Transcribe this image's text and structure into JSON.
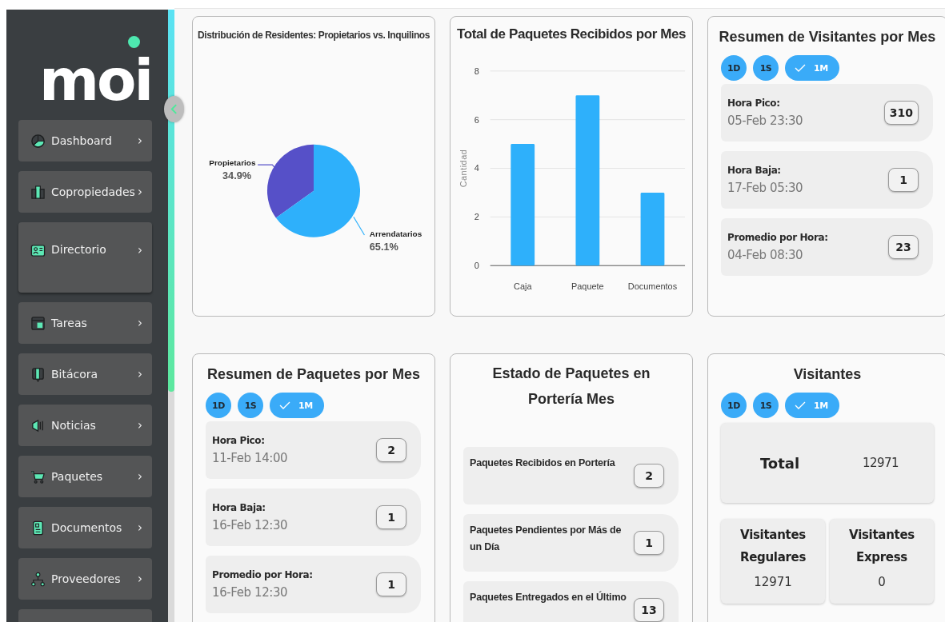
{
  "sidebar": {
    "logo": "moi",
    "items": [
      {
        "label": "Dashboard",
        "chevron": "›"
      },
      {
        "label": "Copropiedades",
        "chevron": "›"
      },
      {
        "label": "Directorio",
        "chevron": "›"
      },
      {
        "label": "Tareas",
        "chevron": "›"
      },
      {
        "label": "Bitácora",
        "chevron": "›"
      },
      {
        "label": "Noticias",
        "chevron": "›"
      },
      {
        "label": "Paquetes",
        "chevron": "›"
      },
      {
        "label": "Documentos",
        "chevron": "›"
      },
      {
        "label": "Proveedores",
        "chevron": "›"
      }
    ]
  },
  "residents_card": {
    "chart_data": {
      "type": "pie",
      "title": "Distribución de Residentes: Propietarios vs. Inquilinos",
      "categories": [
        "Propietarios",
        "Arrendatarios"
      ],
      "values": [
        34.9,
        65.1
      ],
      "value_labels": [
        "34.9%",
        "65.1%"
      ],
      "colors": [
        "#5650c8",
        "#2eb0fb"
      ]
    }
  },
  "packages_chart_card": {
    "chart_data": {
      "type": "bar",
      "title": "Total de Paquetes Recibidos por Mes",
      "ylabel": "Cantidad",
      "categories": [
        "Caja",
        "Paquete",
        "Documentos"
      ],
      "values": [
        5,
        7,
        3
      ],
      "ylim": [
        0,
        8
      ],
      "yticks": [
        0,
        2,
        4,
        6,
        8
      ],
      "grid": true
    }
  },
  "visitor_summary": {
    "title": "Resumen de Visitantes por Mes",
    "periods": [
      {
        "label": "1D",
        "selected": false
      },
      {
        "label": "1S",
        "selected": false
      },
      {
        "label": "1M",
        "selected": true
      }
    ],
    "stats": [
      {
        "label": "Hora Pico:",
        "time": "05-Feb 23:30",
        "value": "310"
      },
      {
        "label": "Hora Baja:",
        "time": "17-Feb 05:30",
        "value": "1"
      },
      {
        "label": "Promedio por Hora:",
        "time": "04-Feb 08:30",
        "value": "23"
      }
    ]
  },
  "package_summary": {
    "title": "Resumen de Paquetes por Mes",
    "periods": [
      {
        "label": "1D",
        "selected": false
      },
      {
        "label": "1S",
        "selected": false
      },
      {
        "label": "1M",
        "selected": true
      }
    ],
    "stats": [
      {
        "label": "Hora Pico:",
        "time": "11-Feb 14:00",
        "value": "2"
      },
      {
        "label": "Hora Baja:",
        "time": "16-Feb 12:30",
        "value": "1"
      },
      {
        "label": "Promedio por Hora:",
        "time": "16-Feb 12:30",
        "value": "1"
      }
    ]
  },
  "package_status": {
    "title": "Estado de Paquetes en Portería Mes",
    "items": [
      {
        "label": "Paquetes Recibidos en Portería",
        "value": "2"
      },
      {
        "label": "Paquetes Pendientes por Más de un Día",
        "value": "1"
      },
      {
        "label": "Paquetes Entregados en el Último",
        "value": "13"
      }
    ]
  },
  "visitors": {
    "title": "Visitantes",
    "periods": [
      {
        "label": "1D",
        "selected": false
      },
      {
        "label": "1S",
        "selected": false
      },
      {
        "label": "1M",
        "selected": true
      }
    ],
    "total": {
      "label": "Total",
      "value": "12971"
    },
    "breakdown": [
      {
        "label": "Visitantes Regulares",
        "value": "12971"
      },
      {
        "label": "Visitantes Express",
        "value": "0"
      }
    ]
  }
}
